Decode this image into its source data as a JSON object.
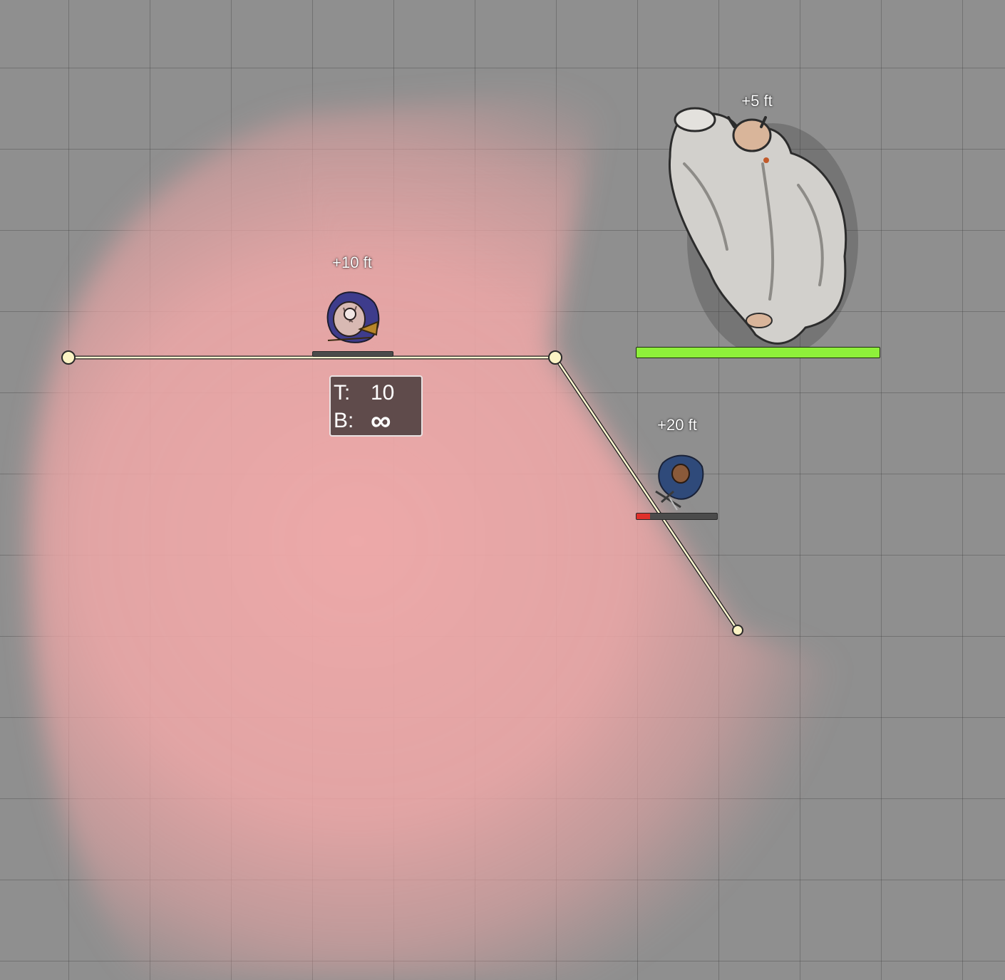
{
  "map": {
    "grid_visible": true,
    "aura_color": "#f2aaaa"
  },
  "tokens": [
    {
      "id": "horned-hero",
      "elevation_label": "+10 ft",
      "hp_fraction": 0.0
    },
    {
      "id": "yeti",
      "elevation_label": "+5 ft",
      "hp_fraction": 1.0,
      "bar_color": "#8ef03a"
    },
    {
      "id": "crossbow-scout",
      "elevation_label": "+20 ft",
      "hp_fraction": 0.17,
      "bar_color": "#e0302a"
    }
  ],
  "ruler": {
    "waypoint_count": 3
  },
  "stat_box": {
    "t_label": "T:",
    "t_value": "10",
    "b_label": "B:",
    "b_value": "∞"
  }
}
